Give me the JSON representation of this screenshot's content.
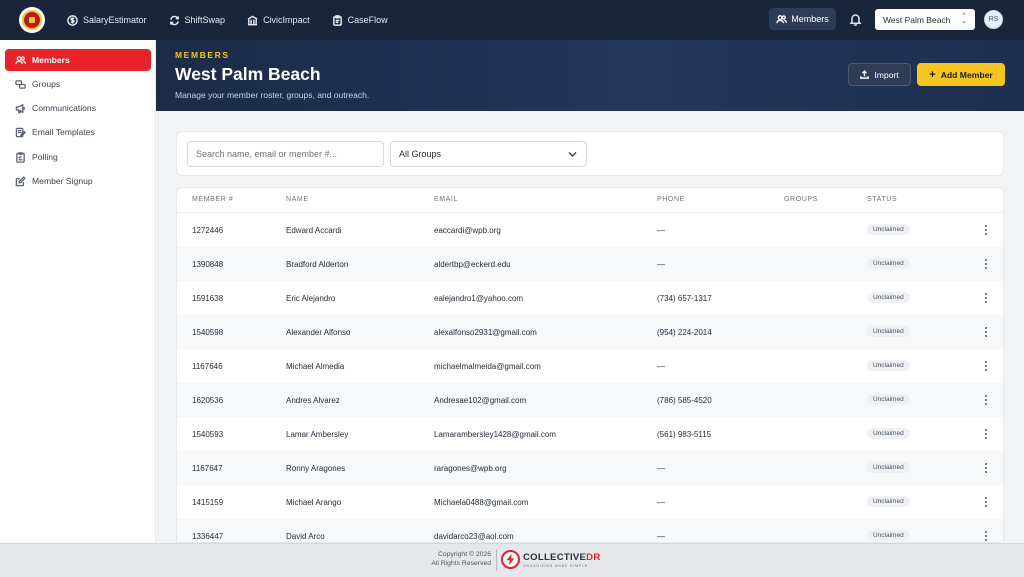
{
  "topbar": {
    "apps": [
      {
        "label": "SalaryEstimator",
        "icon": "dollar-circle-icon"
      },
      {
        "label": "ShiftSwap",
        "icon": "swap-icon"
      },
      {
        "label": "CivicImpact",
        "icon": "building-icon"
      },
      {
        "label": "CaseFlow",
        "icon": "clipboard-icon"
      }
    ],
    "members_label": "Members",
    "location": "West Palm Beach",
    "avatar_initials": "RS"
  },
  "sidebar": {
    "items": [
      {
        "label": "Members",
        "active": true
      },
      {
        "label": "Groups"
      },
      {
        "label": "Communications"
      },
      {
        "label": "Email Templates"
      },
      {
        "label": "Polling"
      },
      {
        "label": "Member Signup"
      }
    ]
  },
  "hero": {
    "kicker": "MEMBERS",
    "title": "West Palm Beach",
    "subtitle": "Manage your member roster, groups, and outreach.",
    "import_label": "Import",
    "add_label": "Add Member"
  },
  "filters": {
    "search_placeholder": "Search name, email or member #...",
    "group_value": "All Groups"
  },
  "table": {
    "columns": [
      "MEMBER #",
      "NAME",
      "EMAIL",
      "PHONE",
      "GROUPS",
      "STATUS"
    ],
    "rows": [
      {
        "member": "1272446",
        "name": "Edward Accardi",
        "email": "eaccardi@wpb.org",
        "phone": "—",
        "groups": "",
        "status": "Unclaimed"
      },
      {
        "member": "1390848",
        "name": "Bradford Alderton",
        "email": "aldertbp@eckerd.edu",
        "phone": "—",
        "groups": "",
        "status": "Unclaimed"
      },
      {
        "member": "1591638",
        "name": "Eric Alejandro",
        "email": "ealejandro1@yahoo.com",
        "phone": "(734) 657-1317",
        "groups": "",
        "status": "Unclaimed"
      },
      {
        "member": "1540598",
        "name": "Alexander Alfonso",
        "email": "alexalfonso2931@gmail.com",
        "phone": "(954) 224-2014",
        "groups": "",
        "status": "Unclaimed"
      },
      {
        "member": "1167646",
        "name": "Michael Almedia",
        "email": "michaelmalmeida@gmail.com",
        "phone": "—",
        "groups": "",
        "status": "Unclaimed"
      },
      {
        "member": "1620536",
        "name": "Andres Alvarez",
        "email": "Andresae102@gmail.com",
        "phone": "(786) 585-4520",
        "groups": "",
        "status": "Unclaimed"
      },
      {
        "member": "1540593",
        "name": "Lamar Ambersley",
        "email": "Lamarambersley1428@gmail.com",
        "phone": "(561) 983-5115",
        "groups": "",
        "status": "Unclaimed"
      },
      {
        "member": "1167647",
        "name": "Ronny Aragones",
        "email": "raragones@wpb.org",
        "phone": "—",
        "groups": "",
        "status": "Unclaimed"
      },
      {
        "member": "1415159",
        "name": "Michael Arango",
        "email": "Michaela0488@gmail.com",
        "phone": "—",
        "groups": "",
        "status": "Unclaimed"
      },
      {
        "member": "1336447",
        "name": "David Arco",
        "email": "davidarco23@aol.com",
        "phone": "—",
        "groups": "",
        "status": "Unclaimed"
      }
    ]
  },
  "footer": {
    "copyright_line1": "Copyright © 2026",
    "copyright_line2": "All Rights Reserved",
    "brand_main": "COLLECTIVE",
    "brand_accent": "DR",
    "brand_tagline": "ORGANIZING MADE SIMPLE"
  },
  "colors": {
    "nav_bg": "#18253b",
    "active_red": "#e8222b",
    "accent_yellow": "#f6c51f"
  }
}
